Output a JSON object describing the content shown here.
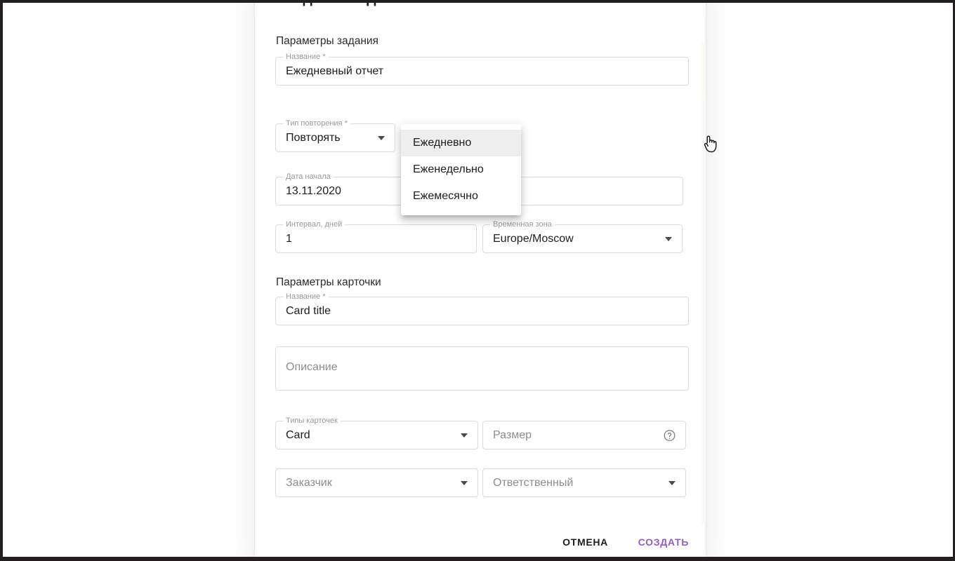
{
  "dialog": {
    "title": "Создание задания",
    "sections": {
      "task": "Параметры задания",
      "card": "Параметры карточки"
    }
  },
  "fields": {
    "task_name": {
      "label": "Название *",
      "value": "Ежедневный отчет"
    },
    "repeat_type": {
      "label": "Тип повторения *",
      "value": "Повторять"
    },
    "start_date": {
      "label": "Дата начала",
      "value": "13.11.2020"
    },
    "interval": {
      "label": "Интервал, дней",
      "value": "1"
    },
    "timezone": {
      "label": "Временная зона",
      "value": "Europe/Moscow"
    },
    "card_title": {
      "label": "Название *",
      "value": "Card title"
    },
    "description": {
      "placeholder": "Описание"
    },
    "card_type": {
      "label": "Типы карточек",
      "value": "Card"
    },
    "size": {
      "placeholder": "Размер"
    },
    "customer": {
      "placeholder": "Заказчик"
    },
    "assignee": {
      "placeholder": "Ответственный"
    }
  },
  "repeat_menu": {
    "open": true,
    "items": [
      {
        "label": "Ежедневно",
        "hovered": true
      },
      {
        "label": "Еженедельно",
        "hovered": false
      },
      {
        "label": "Ежемесячно",
        "hovered": false
      }
    ]
  },
  "actions": {
    "cancel": "Отмена",
    "create": "Создать"
  },
  "colors": {
    "accent": "#8d5ecb",
    "text": "#1d1d1d",
    "muted": "#8d8d8d",
    "field_border": "#dcdcdc",
    "menu_hover": "#eeeeee",
    "frame": "#231f20"
  },
  "icons": {
    "caret": "chevron-down-icon",
    "help": "help-circle-icon",
    "cursor": "pointer-hand-cursor"
  }
}
